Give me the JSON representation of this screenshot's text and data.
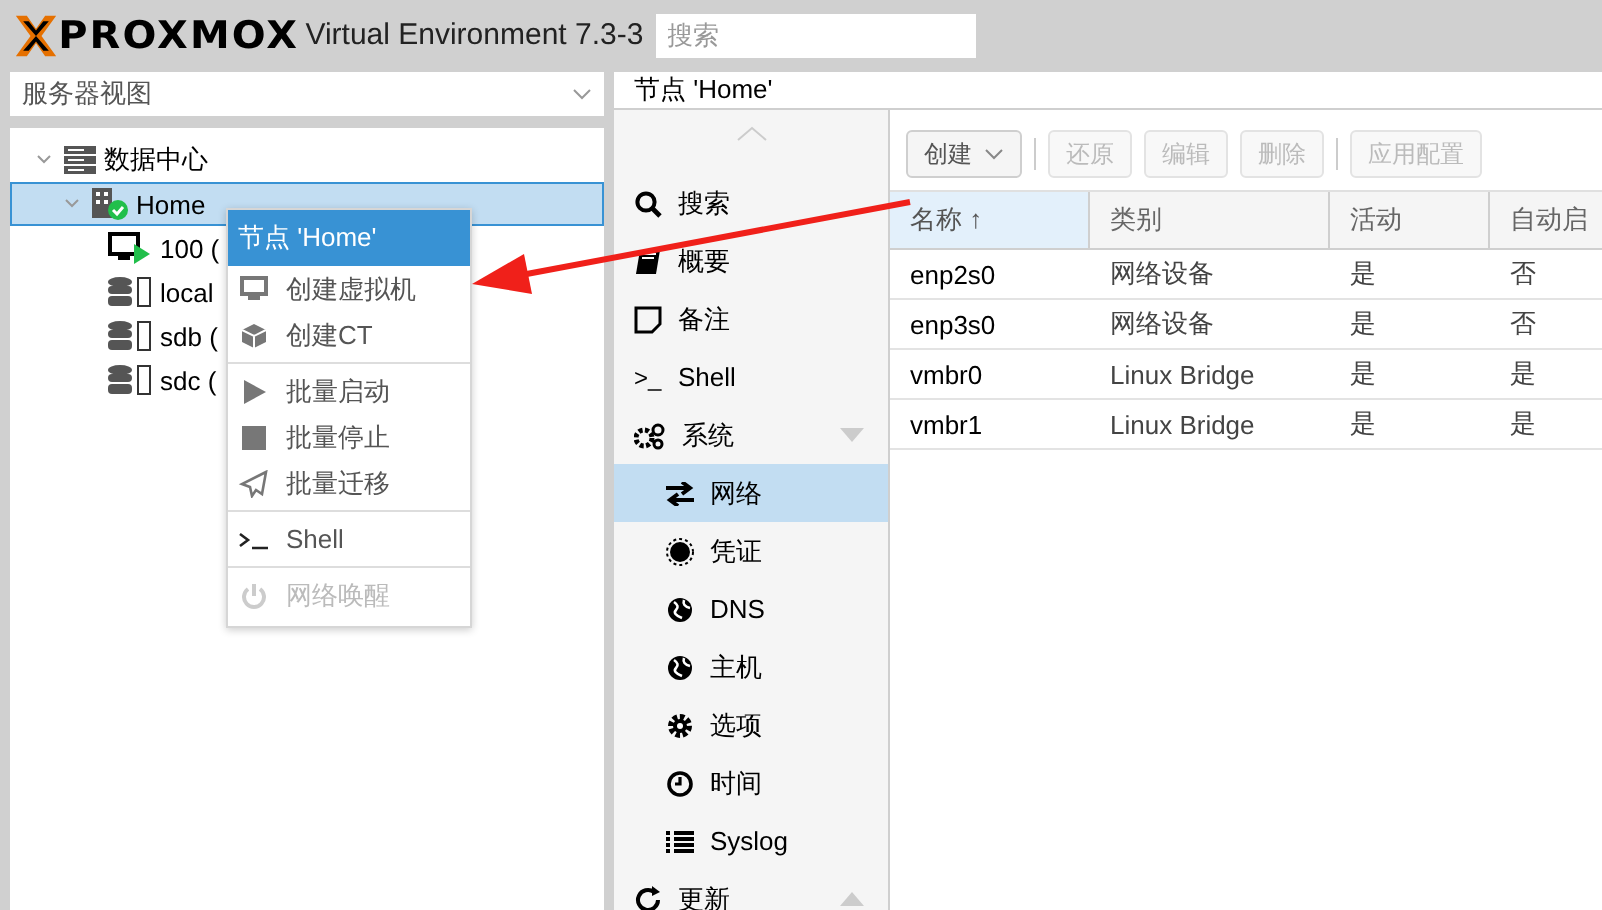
{
  "header": {
    "logo": "PROXMOX",
    "product": "Virtual Environment 7.3-3",
    "search": {
      "placeholder": "搜索"
    }
  },
  "view_selector": {
    "value": "服务器视图"
  },
  "tree": [
    {
      "label": "数据中心",
      "kind": "datacenter",
      "expanded": true,
      "selected": false,
      "children": [
        {
          "label": "Home",
          "kind": "node",
          "expanded": true,
          "selected": true,
          "children": [
            {
              "label": "100 (",
              "kind": "vm",
              "selected": false
            },
            {
              "label": "local",
              "kind": "storage",
              "selected": false
            },
            {
              "label": "sdb (",
              "kind": "storage",
              "selected": false
            },
            {
              "label": "sdc (",
              "kind": "storage",
              "selected": false
            }
          ]
        }
      ]
    }
  ],
  "context_menu": {
    "title": "节点 'Home'",
    "items": [
      {
        "kind": "item",
        "label": "创建虚拟机",
        "disabled": false
      },
      {
        "kind": "item",
        "label": "创建CT",
        "disabled": false
      },
      {
        "kind": "separator"
      },
      {
        "kind": "item",
        "label": "批量启动",
        "disabled": false
      },
      {
        "kind": "item",
        "label": "批量停止",
        "disabled": false
      },
      {
        "kind": "item",
        "label": "批量迁移",
        "disabled": false
      },
      {
        "kind": "separator"
      },
      {
        "kind": "item",
        "label": "Shell",
        "disabled": false
      },
      {
        "kind": "separator"
      },
      {
        "kind": "item",
        "label": "网络唤醒",
        "disabled": true
      }
    ]
  },
  "panel": {
    "title": "节点 'Home'"
  },
  "nav": [
    {
      "label": "搜索",
      "selected": false
    },
    {
      "label": "概要",
      "selected": false
    },
    {
      "label": "备注",
      "selected": false
    },
    {
      "label": ">_",
      "kind": "text-icon",
      "label2": "Shell",
      "selected": false
    },
    {
      "label": "系统",
      "selected": false,
      "expanded": true,
      "children": [
        {
          "label": "网络",
          "selected": true
        },
        {
          "label": "凭证",
          "selected": false
        },
        {
          "label": "DNS",
          "selected": false
        },
        {
          "label": "主机",
          "selected": false
        },
        {
          "label": "选项",
          "selected": false
        },
        {
          "label": "时间",
          "selected": false
        },
        {
          "label": "Syslog",
          "selected": false
        }
      ]
    },
    {
      "label": "更新",
      "selected": false,
      "expanded": false
    }
  ],
  "toolbar": [
    {
      "kind": "menu",
      "label": "创建",
      "disabled": false
    },
    {
      "kind": "separator"
    },
    {
      "kind": "button",
      "label": "还原",
      "disabled": true
    },
    {
      "kind": "button",
      "label": "编辑",
      "disabled": true
    },
    {
      "kind": "button",
      "label": "删除",
      "disabled": true
    },
    {
      "kind": "separator"
    },
    {
      "kind": "button",
      "label": "应用配置",
      "disabled": true
    }
  ],
  "table": {
    "columns": [
      {
        "label": "名称 ↑",
        "sorted": true
      },
      {
        "label": "类别",
        "sorted": false
      },
      {
        "label": "活动",
        "sorted": false
      },
      {
        "label": "自动启",
        "sorted": false
      }
    ],
    "rows": [
      [
        "enp2s0",
        "网络设备",
        "是",
        "否"
      ],
      [
        "enp3s0",
        "网络设备",
        "是",
        "否"
      ],
      [
        "vmbr0",
        "Linux Bridge",
        "是",
        "是"
      ],
      [
        "vmbr1",
        "Linux Bridge",
        "是",
        "是"
      ]
    ]
  }
}
